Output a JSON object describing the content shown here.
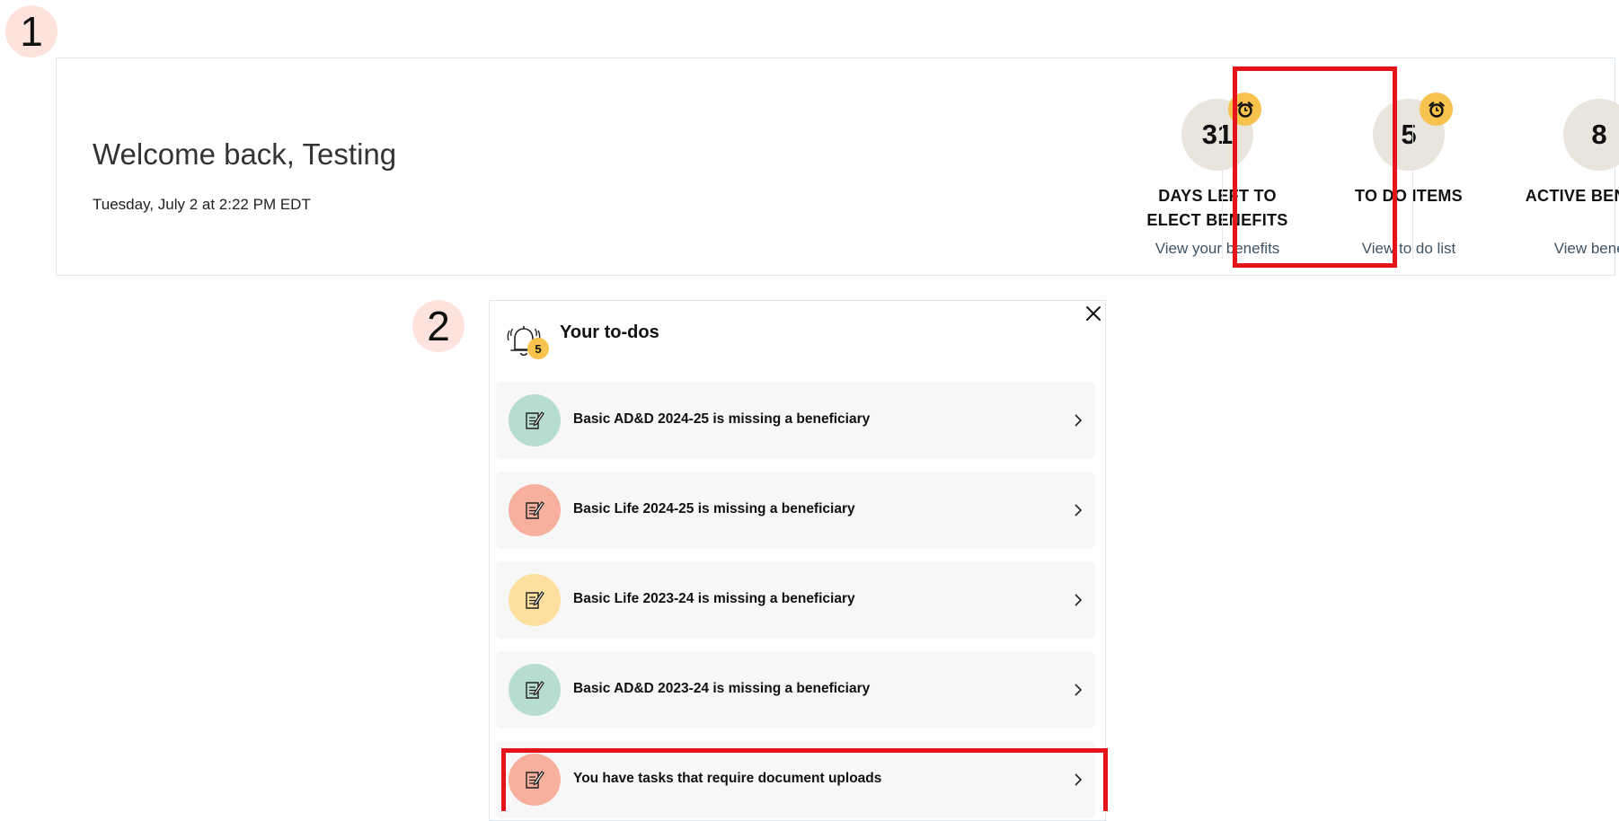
{
  "annotations": {
    "step1_number": "1",
    "step2_number": "2"
  },
  "header": {
    "welcome": "Welcome back, Testing",
    "date": "Tuesday, July 2 at 2:22 PM EDT"
  },
  "stats": [
    {
      "value": "31",
      "label_line1": "DAYS LEFT TO",
      "label_line2": "ELECT BENEFITS",
      "link": "View your benefits",
      "has_alarm": true
    },
    {
      "value": "5",
      "label_line1": "TO DO ITEMS",
      "label_line2": "",
      "link": "View to do list",
      "has_alarm": true
    },
    {
      "value": "8",
      "label_line1": "ACTIVE BENEFITS",
      "label_line2": "",
      "link": "View benefits",
      "has_alarm": false
    }
  ],
  "todo_panel": {
    "title": "Your to-dos",
    "badge_count": "5",
    "items": [
      {
        "text": "Basic AD&D 2024-25 is missing a beneficiary",
        "icon_color": "#b7ddd2"
      },
      {
        "text": "Basic Life 2024-25 is missing a beneficiary",
        "icon_color": "#f6b09d"
      },
      {
        "text": "Basic Life 2023-24 is missing a beneficiary",
        "icon_color": "#fde0a0"
      },
      {
        "text": "Basic AD&D 2023-24 is missing a beneficiary",
        "icon_color": "#b7ddd2"
      },
      {
        "text": "You have tasks that require document uploads",
        "icon_color": "#f6b09d"
      }
    ]
  },
  "colors": {
    "highlight": "#e5141a",
    "alarm_badge": "#f7c34e",
    "stat_circle": "#e9e4dc",
    "step_badge": "#fde3dc"
  },
  "icons": {
    "alarm": "alarm-clock-icon",
    "bell": "bell-icon",
    "close": "close-icon",
    "document": "document-edit-icon",
    "chevron": "chevron-right-icon"
  }
}
